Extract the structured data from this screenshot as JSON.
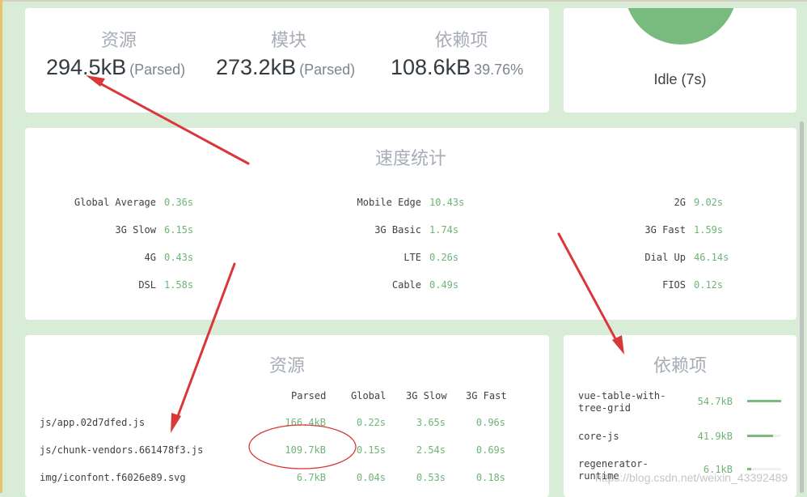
{
  "stats": [
    {
      "label": "资源",
      "value": "294.5kB",
      "sub": "(Parsed)"
    },
    {
      "label": "模块",
      "value": "273.2kB",
      "sub": "(Parsed)"
    },
    {
      "label": "依赖项",
      "value": "108.6kB",
      "sub": "39.76%"
    }
  ],
  "status": {
    "text": "Idle (7s)"
  },
  "speed": {
    "title": "速度统计",
    "columns": [
      [
        {
          "label": "Global Average",
          "value": "0.36s"
        },
        {
          "label": "3G Slow",
          "value": "6.15s"
        },
        {
          "label": "4G",
          "value": "0.43s"
        },
        {
          "label": "DSL",
          "value": "1.58s"
        }
      ],
      [
        {
          "label": "Mobile Edge",
          "value": "10.43s"
        },
        {
          "label": "3G Basic",
          "value": "1.74s"
        },
        {
          "label": "LTE",
          "value": "0.26s"
        },
        {
          "label": "Cable",
          "value": "0.49s"
        }
      ],
      [
        {
          "label": "2G",
          "value": "9.02s"
        },
        {
          "label": "3G Fast",
          "value": "1.59s"
        },
        {
          "label": "Dial Up",
          "value": "46.14s"
        },
        {
          "label": "FIOS",
          "value": "0.12s"
        }
      ]
    ]
  },
  "assets": {
    "title": "资源",
    "headers": [
      "Parsed",
      "Global",
      "3G Slow",
      "3G Fast"
    ],
    "rows": [
      {
        "name": "js/app.02d7dfed.js",
        "cells": [
          "166.4kB",
          "0.22s",
          "3.65s",
          "0.96s"
        ]
      },
      {
        "name": "js/chunk-vendors.661478f3.js",
        "cells": [
          "109.7kB",
          "0.15s",
          "2.54s",
          "0.69s"
        ]
      },
      {
        "name": "img/iconfont.f6026e89.svg",
        "cells": [
          "6.7kB",
          "0.04s",
          "0.53s",
          "0.18s"
        ]
      }
    ]
  },
  "deps": {
    "title": "依赖项",
    "items": [
      {
        "name": "vue-table-with-tree-grid",
        "size": "54.7kB",
        "fraction": 1.0
      },
      {
        "name": "core-js",
        "size": "41.9kB",
        "fraction": 0.77
      },
      {
        "name": "regenerator-runtime",
        "size": "6.1kB",
        "fraction": 0.11
      }
    ]
  },
  "watermark": "https://blog.csdn.net/weixin_43392489",
  "colors": {
    "accent": "#79ba7f",
    "value_green": "#6fb477",
    "annotation_red": "#d9383a",
    "background": "#d9ecd7"
  }
}
